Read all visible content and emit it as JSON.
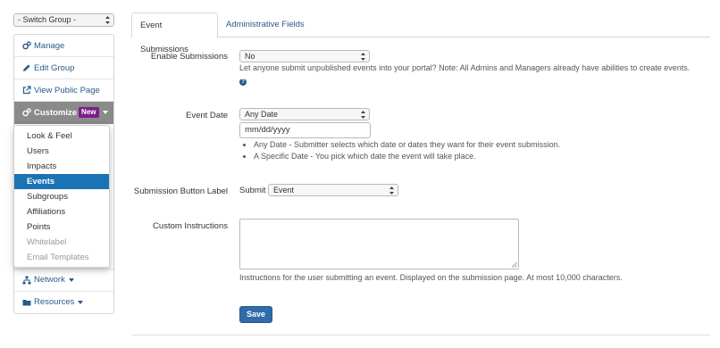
{
  "switch_group": {
    "label": "- Switch Group -"
  },
  "sidebar": {
    "items": [
      {
        "label": "Manage",
        "icon": "cogs-icon"
      },
      {
        "label": "Edit Group",
        "icon": "pencil-icon"
      },
      {
        "label": "View Public Page",
        "icon": "external-link-icon"
      },
      {
        "label": "Customize",
        "icon": "cogs-icon",
        "badge": "New"
      }
    ],
    "bottom_items": [
      {
        "label": "Network",
        "icon": "sitemap-icon"
      },
      {
        "label": "Resources",
        "icon": "folder-icon"
      }
    ]
  },
  "customize_menu": {
    "items": [
      {
        "label": "Look & Feel"
      },
      {
        "label": "Users"
      },
      {
        "label": "Impacts"
      },
      {
        "label": "Events"
      },
      {
        "label": "Subgroups"
      },
      {
        "label": "Affiliations"
      },
      {
        "label": "Points"
      },
      {
        "label": "Whitelabel"
      },
      {
        "label": "Email Templates"
      }
    ]
  },
  "tabs": [
    {
      "label": "Event Submissions"
    },
    {
      "label": "Administrative Fields"
    }
  ],
  "form": {
    "enable": {
      "label": "Enable Submissions",
      "value": "No",
      "help": "Let anyone submit unpublished events into your portal? Note: All Admins and Managers already have abilities to create events."
    },
    "event_date": {
      "label": "Event Date",
      "value": "Any Date",
      "input_placeholder": "mm/dd/yyyy",
      "bullets": [
        "Any Date - Submitter selects which date or dates they want for their event submission.",
        "A Specific Date - You pick which date the event will take place."
      ]
    },
    "button_label": {
      "label": "Submission Button Label",
      "prefix": "Submit",
      "value": "Event"
    },
    "instructions": {
      "label": "Custom Instructions",
      "value": "",
      "help": "Instructions for the user submitting an event. Displayed on the submission page. At most 10,000 characters."
    },
    "save_label": "Save"
  },
  "colors": {
    "accent": "#1a73b5",
    "link": "#2a5a8a",
    "badge": "#7a1f86",
    "active_nav": "#8a8a8a",
    "button": "#2f6ca8"
  }
}
